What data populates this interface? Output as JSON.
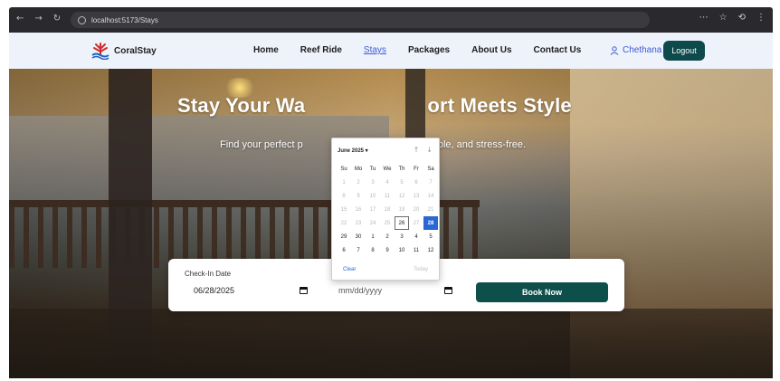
{
  "browser": {
    "url": "localhost:5173/Stays",
    "nav_glyphs": [
      "←",
      "→",
      "↻"
    ],
    "right_glyphs": [
      "⋯",
      "☆",
      "⟲",
      "⋮"
    ]
  },
  "nav": {
    "brand": "CoralStay",
    "items": [
      {
        "label": "Home",
        "active": false
      },
      {
        "label": "Reef Ride",
        "active": false
      },
      {
        "label": "Stays",
        "active": true
      },
      {
        "label": "Packages",
        "active": false
      },
      {
        "label": "About Us",
        "active": false
      },
      {
        "label": "Contact Us",
        "active": false
      }
    ],
    "user": "Chethana",
    "logout": "Logout"
  },
  "hero": {
    "headline_left": "Stay Your Wa",
    "headline_right": "ort Meets Style",
    "sub_left": "Find your perfect p",
    "sub_right": "simple, and stress-free."
  },
  "booking": {
    "checkin_label": "Check-In Date",
    "checkin_value": "06/28/2025",
    "checkout_placeholder": "mm/dd/yyyy",
    "book_label": "Book Now"
  },
  "datepicker": {
    "month_label": "June 2025 ▾",
    "arrows": [
      "↑",
      "↓"
    ],
    "weekdays": [
      "Su",
      "Mo",
      "Tu",
      "We",
      "Th",
      "Fr",
      "Sa"
    ],
    "rows": [
      [
        "1",
        "2",
        "3",
        "4",
        "5",
        "6",
        "7"
      ],
      [
        "8",
        "9",
        "10",
        "11",
        "12",
        "13",
        "14"
      ],
      [
        "15",
        "16",
        "17",
        "18",
        "19",
        "20",
        "21"
      ],
      [
        "22",
        "23",
        "24",
        "25",
        "26",
        "27",
        "28"
      ],
      [
        "29",
        "30",
        "1",
        "2",
        "3",
        "4",
        "5"
      ],
      [
        "6",
        "7",
        "8",
        "9",
        "10",
        "11",
        "12"
      ]
    ],
    "today": "26",
    "selected": "28",
    "clear": "Clear",
    "today_btn": "Today"
  },
  "colors": {
    "accent": "#0e4a4b",
    "link_active": "#3a5bd6",
    "selected_day": "#2a66d6"
  }
}
